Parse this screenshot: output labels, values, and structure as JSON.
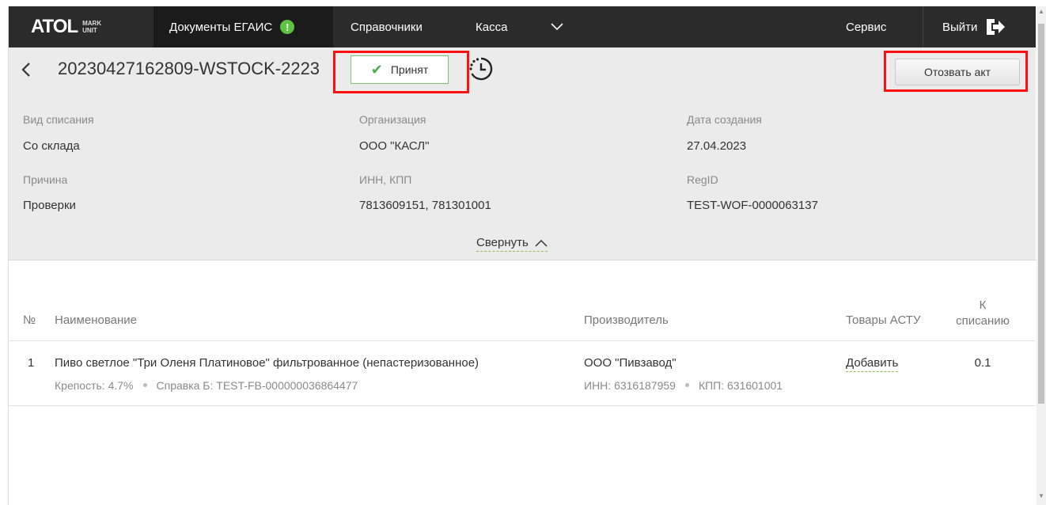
{
  "nav": {
    "logo_main": "ATOL",
    "logo_sub_line1": "MARK",
    "logo_sub_line2": "UNIT",
    "docs_label": "Документы ЕГАИС",
    "docs_alert": "!",
    "reference_label": "Справочники",
    "kassa_label": "Касса",
    "service_label": "Сервис",
    "exit_label": "Выйти"
  },
  "header": {
    "doc_id": "20230427162809-WSTOCK-2223",
    "status": "Принят",
    "revoke_label": "Отозвать акт"
  },
  "details": {
    "writeoff_type_label": "Вид списания",
    "writeoff_type_value": "Со склада",
    "org_label": "Организация",
    "org_value": "ООО \"КАСЛ\"",
    "created_label": "Дата создания",
    "created_value": "27.04.2023",
    "reason_label": "Причина",
    "reason_value": "Проверки",
    "inn_kpp_label": "ИНН, КПП",
    "inn_kpp_value": "7813609151, 781301001",
    "regid_label": "RegID",
    "regid_value": "TEST-WOF-0000063137",
    "collapse_label": "Свернуть"
  },
  "table": {
    "col_num": "№",
    "col_name": "Наименование",
    "col_manufacturer": "Производитель",
    "col_goods": "Товары АСТУ",
    "col_writeoff_1": "К",
    "col_writeoff_2": "списанию",
    "rows": [
      {
        "num": "1",
        "name": "Пиво светлое \"Три Оленя Платиновое\" фильтрованное (непастеризованное)",
        "strength": "Крепость: 4.7%",
        "cert": "Справка Б: TEST-FB-000000036864477",
        "manufacturer": "ООО \"Пивзавод\"",
        "inn": "ИНН: 6316187959",
        "kpp": "КПП: 631601001",
        "goods_action": "Добавить",
        "qty": "0.1"
      }
    ]
  },
  "colors": {
    "topbar": "#2b2b2b",
    "accent_green": "#5cc23f",
    "highlight_red": "#ff1010",
    "panel_bg": "#ebebeb"
  }
}
